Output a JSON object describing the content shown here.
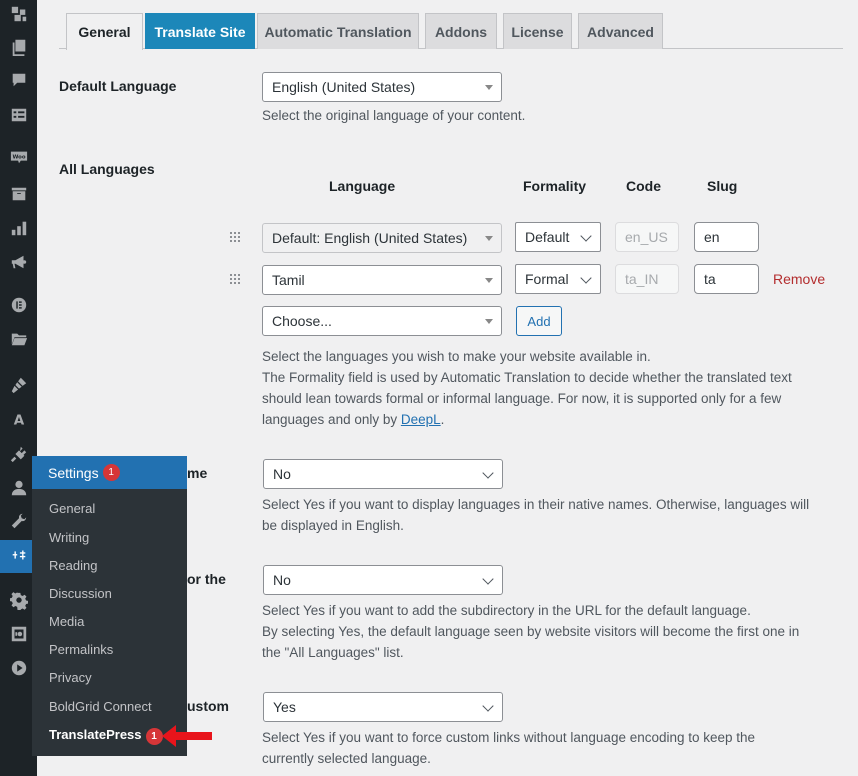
{
  "sidebar": {
    "icons": [
      {
        "name": "boldgrid-icon"
      },
      {
        "name": "pages-icon"
      },
      {
        "name": "comments-icon"
      },
      {
        "name": "forms-icon"
      },
      {
        "name": "woocommerce-icon"
      },
      {
        "name": "products-icon"
      },
      {
        "name": "analytics-icon"
      },
      {
        "name": "marketing-icon"
      },
      {
        "name": "elementor-icon"
      },
      {
        "name": "templates-icon"
      },
      {
        "name": "appearance-icon"
      },
      {
        "name": "fonts-icon"
      },
      {
        "name": "plugins-icon"
      },
      {
        "name": "users-icon"
      },
      {
        "name": "tools-icon"
      },
      {
        "name": "settings-icon",
        "active": true
      },
      {
        "name": "gear-icon"
      },
      {
        "name": "media-icon"
      },
      {
        "name": "video-icon"
      }
    ]
  },
  "tabs": [
    {
      "label": "General",
      "state": "current"
    },
    {
      "label": "Translate Site",
      "state": "highlight"
    },
    {
      "label": "Automatic Translation",
      "state": "normal"
    },
    {
      "label": "Addons",
      "state": "normal"
    },
    {
      "label": "License",
      "state": "normal"
    },
    {
      "label": "Advanced",
      "state": "normal"
    }
  ],
  "default_language": {
    "label": "Default Language",
    "value": "English (United States)",
    "description": "Select the original language of your content."
  },
  "all_languages": {
    "label": "All Languages",
    "columns": {
      "language": "Language",
      "formality": "Formality",
      "code": "Code",
      "slug": "Slug"
    },
    "rows": [
      {
        "language": "Default: English (United States)",
        "formality": "Default",
        "code": "en_US",
        "slug": "en"
      },
      {
        "language": "Tamil",
        "formality": "Formal",
        "code": "ta_IN",
        "slug": "ta",
        "remove": "Remove"
      }
    ],
    "new_row": {
      "placeholder": "Choose...",
      "add_label": "Add"
    },
    "description_1": "Select the languages you wish to make your website available in.",
    "description_2": "The Formality field is used by Automatic Translation to decide whether the translated text",
    "description_3": "should lean towards formal or informal language. For now, it is supported only for a few",
    "description_4_prefix": "languages and only by ",
    "description_4_link": "DeepL",
    "description_4_suffix": "."
  },
  "native_names": {
    "label_partial": "me",
    "value": "No",
    "description_1": "Select Yes if you want to display languages in their native names. Otherwise, languages will",
    "description_2": "be displayed in English."
  },
  "subdirectory": {
    "label_partial": "or the",
    "value": "No",
    "description_1": "Select Yes if you want to add the subdirectory in the URL for the default language.",
    "description_2": "By selecting Yes, the default language seen by website visitors will become the first one in",
    "description_3": "the \"All Languages\" list."
  },
  "force_custom_links": {
    "label_partial": "ustom",
    "value": "Yes",
    "description_1": "Select Yes if you want to force custom links without language encoding to keep the",
    "description_2": "currently selected language."
  },
  "flyout": {
    "title": "Settings",
    "badge": "1",
    "items": [
      {
        "label": "General"
      },
      {
        "label": "Writing"
      },
      {
        "label": "Reading"
      },
      {
        "label": "Discussion"
      },
      {
        "label": "Media"
      },
      {
        "label": "Permalinks"
      },
      {
        "label": "Privacy"
      },
      {
        "label": "BoldGrid Connect"
      },
      {
        "label": "TranslatePress",
        "badge": "1",
        "current": true
      }
    ]
  },
  "colors": {
    "accent": "#2271b1",
    "tab_highlight": "#1c87b9",
    "remove": "#b32d2e",
    "badge": "#d63638",
    "arrow": "#e8141b"
  }
}
